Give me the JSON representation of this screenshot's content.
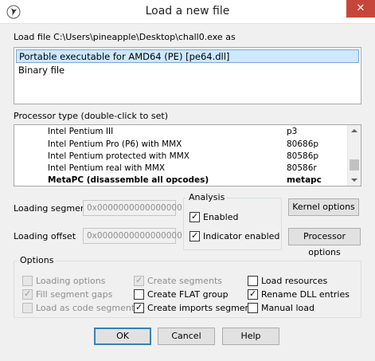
{
  "window": {
    "title": "Load a new file",
    "close_glyph": "✕"
  },
  "load_file": {
    "label": "Load file C:\\Users\\pineapple\\Desktop\\chall0.exe as",
    "options": [
      "Portable executable for AMD64 (PE) [pe64.dll]",
      "Binary file"
    ],
    "selected_index": 0
  },
  "processor": {
    "label": "Processor type (double-click to set)",
    "rows": [
      {
        "name": "Intel Pentium III",
        "code": "p3"
      },
      {
        "name": "Intel Pentium Pro (P6) with MMX",
        "code": "80686p"
      },
      {
        "name": "Intel Pentium protected with MMX",
        "code": "80586p"
      },
      {
        "name": "Intel Pentium real with MMX",
        "code": "80586r"
      },
      {
        "name": "MetaPC (disassemble all opcodes)",
        "code": "metapc"
      }
    ]
  },
  "loading": {
    "segment_label": "Loading segment",
    "segment_value": "0x0000000000000000",
    "offset_label": "Loading offset",
    "offset_value": "0x0000000000000000"
  },
  "analysis": {
    "title": "Analysis",
    "enabled_label": "Enabled",
    "enabled": true,
    "indicator_label": "Indicator enabled",
    "indicator": true
  },
  "buttons": {
    "kernel_options": "Kernel options",
    "processor_options": "Processor options",
    "ok": "OK",
    "cancel": "Cancel",
    "help": "Help"
  },
  "options": {
    "title": "Options",
    "loading_options": {
      "label": "Loading options",
      "checked": false,
      "enabled": false
    },
    "fill_segment_gaps": {
      "label": "Fill segment gaps",
      "checked": true,
      "enabled": false
    },
    "load_as_code_segment": {
      "label": "Load as code segment",
      "checked": false,
      "enabled": false
    },
    "create_segments": {
      "label": "Create segments",
      "checked": true,
      "enabled": false
    },
    "create_flat_group": {
      "label": "Create FLAT group",
      "checked": false,
      "enabled": true
    },
    "create_imports_segment": {
      "label": "Create imports segment",
      "checked": true,
      "enabled": true
    },
    "load_resources": {
      "label": "Load resources",
      "checked": false,
      "enabled": true
    },
    "rename_dll_entries": {
      "label": "Rename DLL entries",
      "checked": true,
      "enabled": true
    },
    "manual_load": {
      "label": "Manual load",
      "checked": false,
      "enabled": true
    }
  }
}
